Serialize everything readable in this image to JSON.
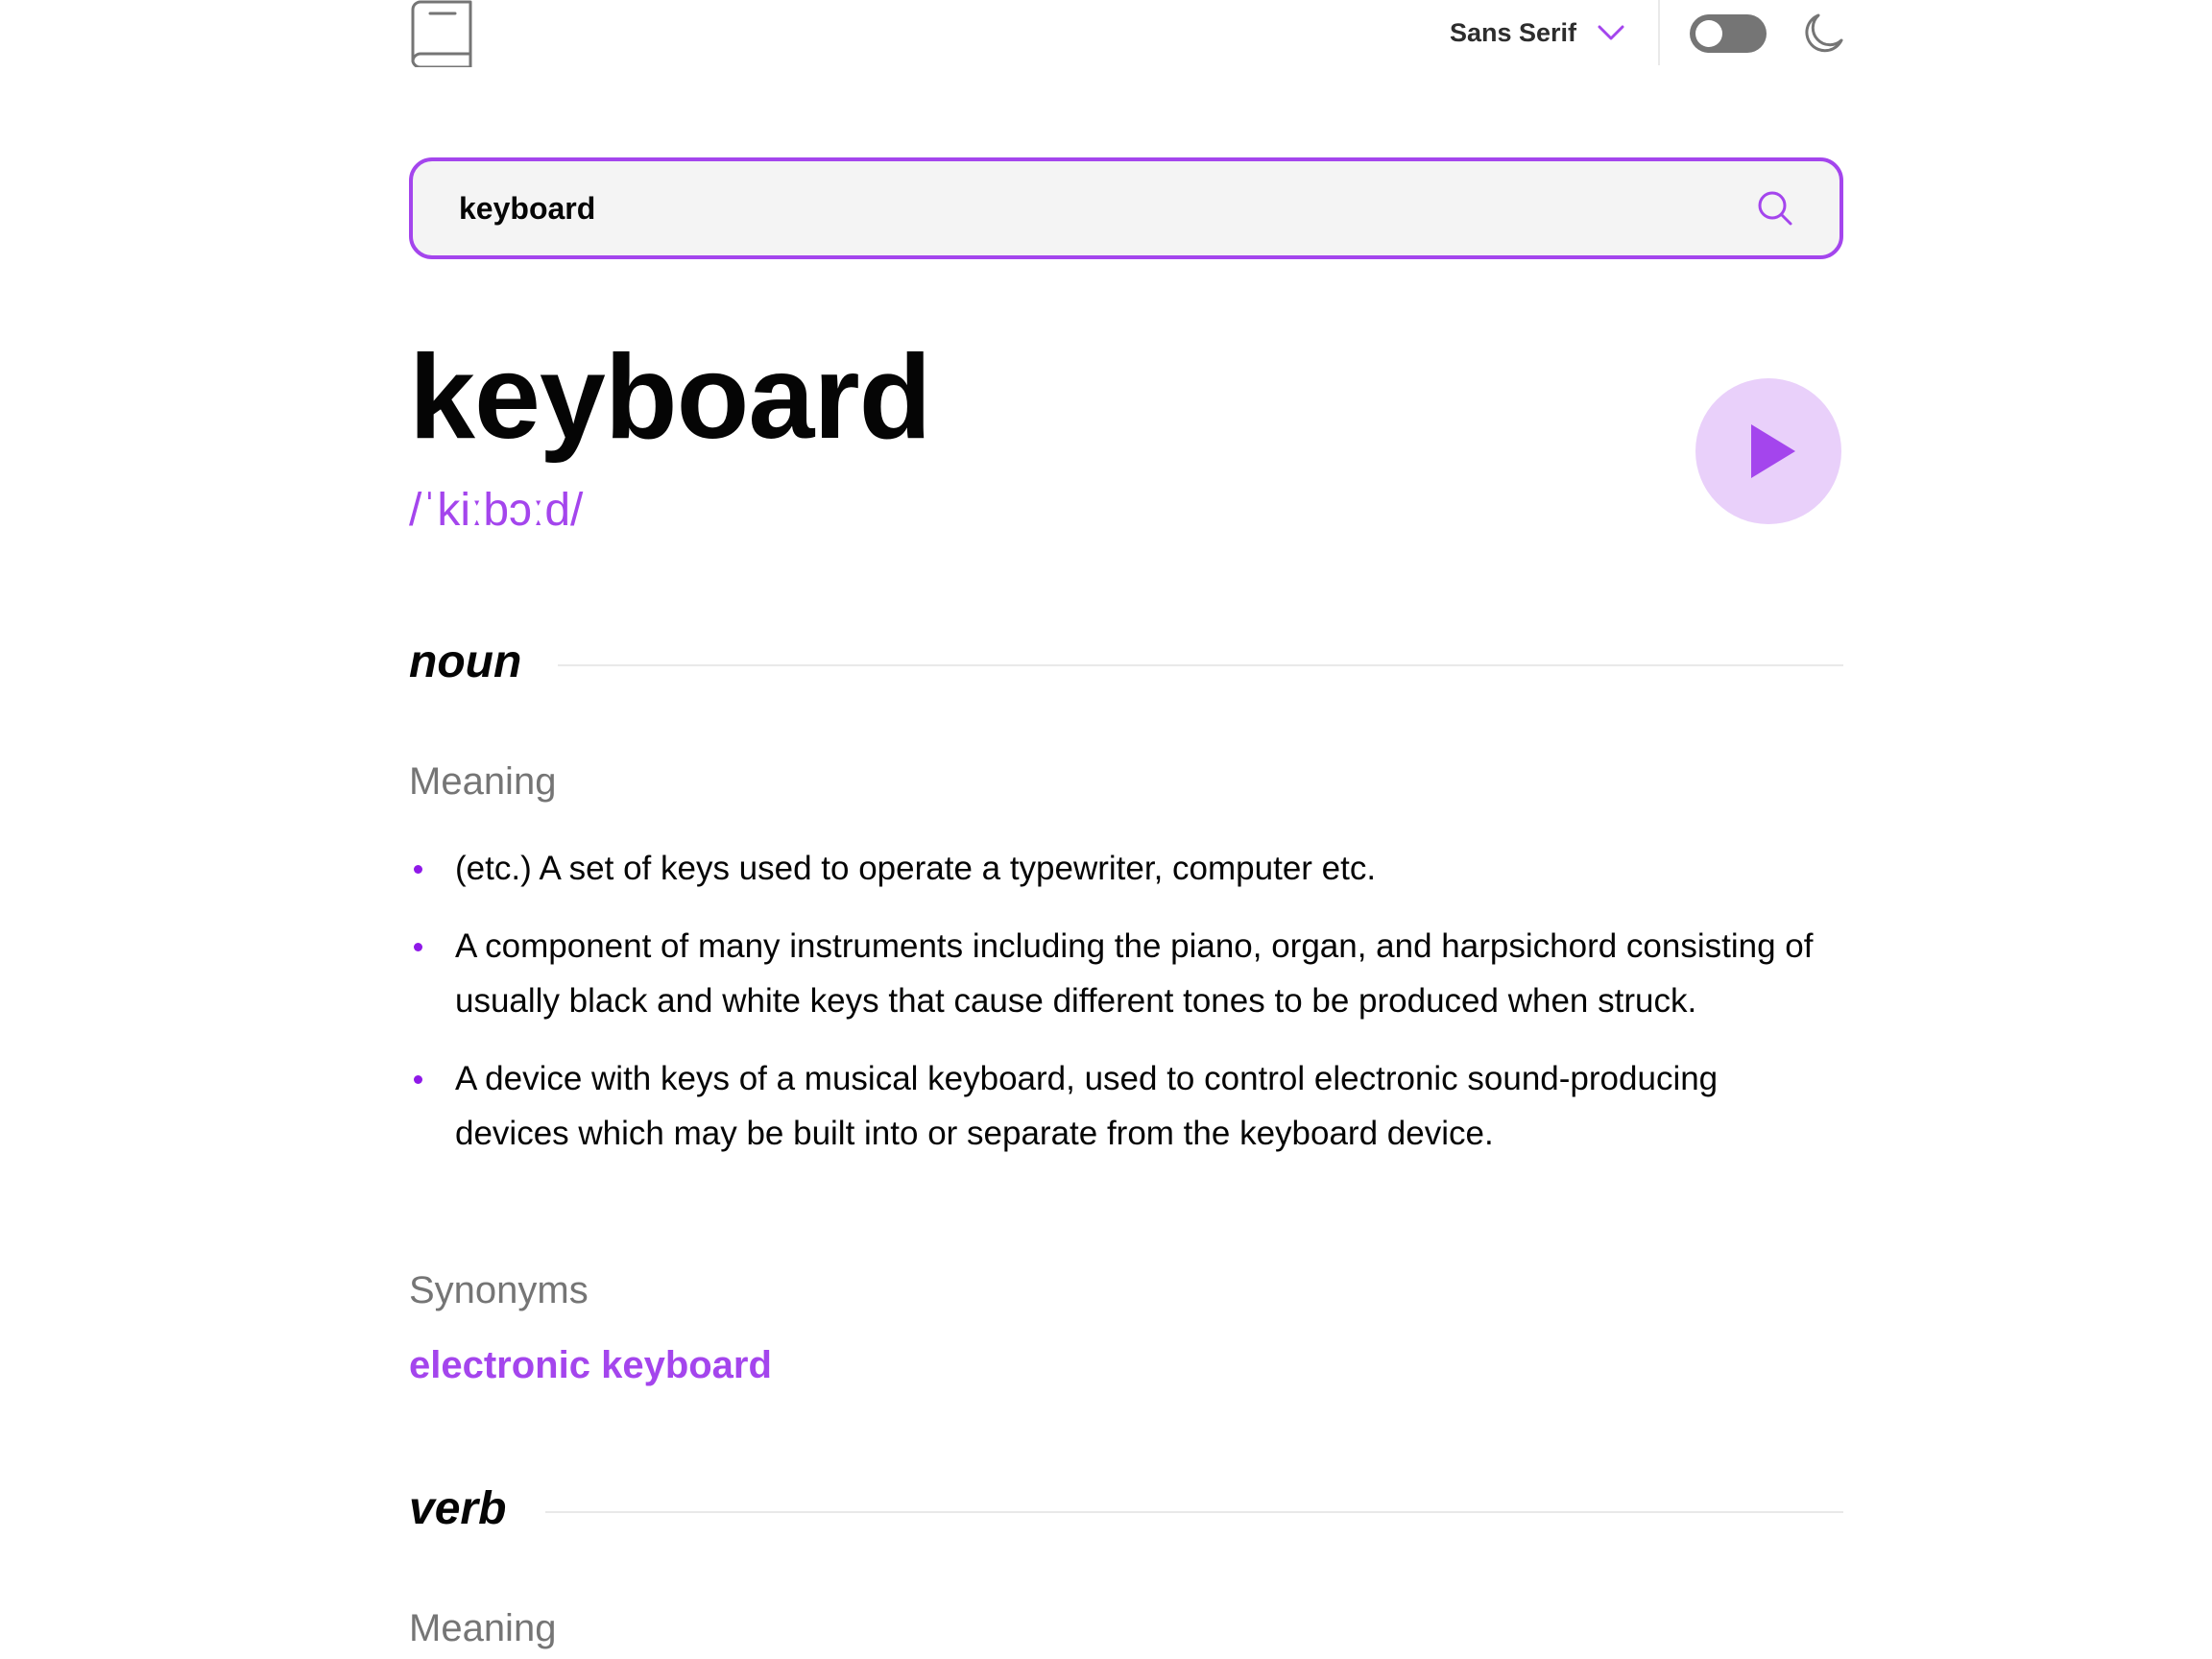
{
  "header": {
    "font_selector": "Sans Serif",
    "theme_toggle_state": "off",
    "icons": {
      "logo": "book-icon",
      "font_dropdown": "chevron-down-icon",
      "theme": "moon-icon"
    }
  },
  "search": {
    "value": "keyboard",
    "placeholder": "",
    "icon": "search-icon"
  },
  "entry": {
    "word": "keyboard",
    "phonetic": "/ˈkiːbɔːd/",
    "play_icon": "play-icon"
  },
  "noun": {
    "part_of_speech": "noun",
    "meaning_label": "Meaning",
    "definitions": [
      "(etc.) A set of keys used to operate a typewriter, computer etc.",
      "A component of many instruments including the piano, organ, and harpsichord consisting of usually black and white keys that cause different tones to be produced when struck.",
      "A device with keys of a musical keyboard, used to control electronic sound-producing devices which may be built into or separate from the keyboard device."
    ],
    "synonyms_label": "Synonyms",
    "synonyms": [
      "electronic keyboard"
    ]
  },
  "verb": {
    "part_of_speech": "verb",
    "meaning_label": "Meaning"
  },
  "colors": {
    "accent": "#A445ED",
    "accent_light": "#E9D0FA",
    "text": "#050505",
    "muted": "#757575",
    "search_bg": "#F4F4F4",
    "rule": "#E9E9E9"
  }
}
